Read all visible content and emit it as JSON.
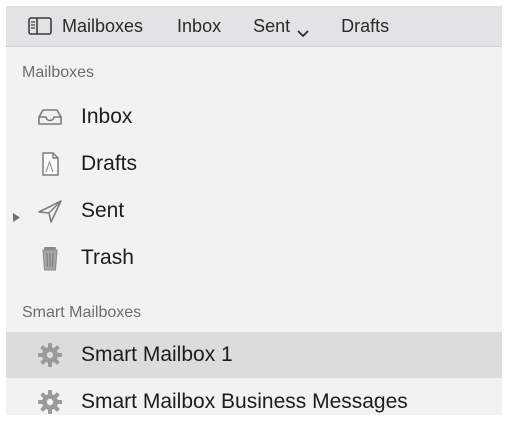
{
  "toolbar": {
    "mailboxes_label": "Mailboxes",
    "inbox_label": "Inbox",
    "sent_label": "Sent",
    "drafts_label": "Drafts",
    "icons": {
      "mailboxes": "sidebar-icon",
      "sent_menu": "chevron-down-icon"
    }
  },
  "sidebar": {
    "mailboxes_header": "Mailboxes",
    "items": [
      {
        "label": "Inbox",
        "icon": "tray-icon"
      },
      {
        "label": "Drafts",
        "icon": "document-icon"
      },
      {
        "label": "Sent",
        "icon": "paper-plane-icon",
        "collapsed": true
      },
      {
        "label": "Trash",
        "icon": "trash-icon"
      }
    ],
    "smart_header": "Smart Mailboxes",
    "smart_items": [
      {
        "label": "Smart Mailbox 1",
        "icon": "gear-icon",
        "selected": true
      },
      {
        "label": "Smart Mailbox Business Messages",
        "icon": "gear-icon",
        "selected": false
      }
    ]
  },
  "colors": {
    "toolbar_bg": "#e3e3e5",
    "sidebar_bg": "#f2f2f2",
    "selected_row_bg": "#dcdcdc",
    "section_header": "#6d6d6d",
    "icon_gray": "#8a8a8a"
  }
}
